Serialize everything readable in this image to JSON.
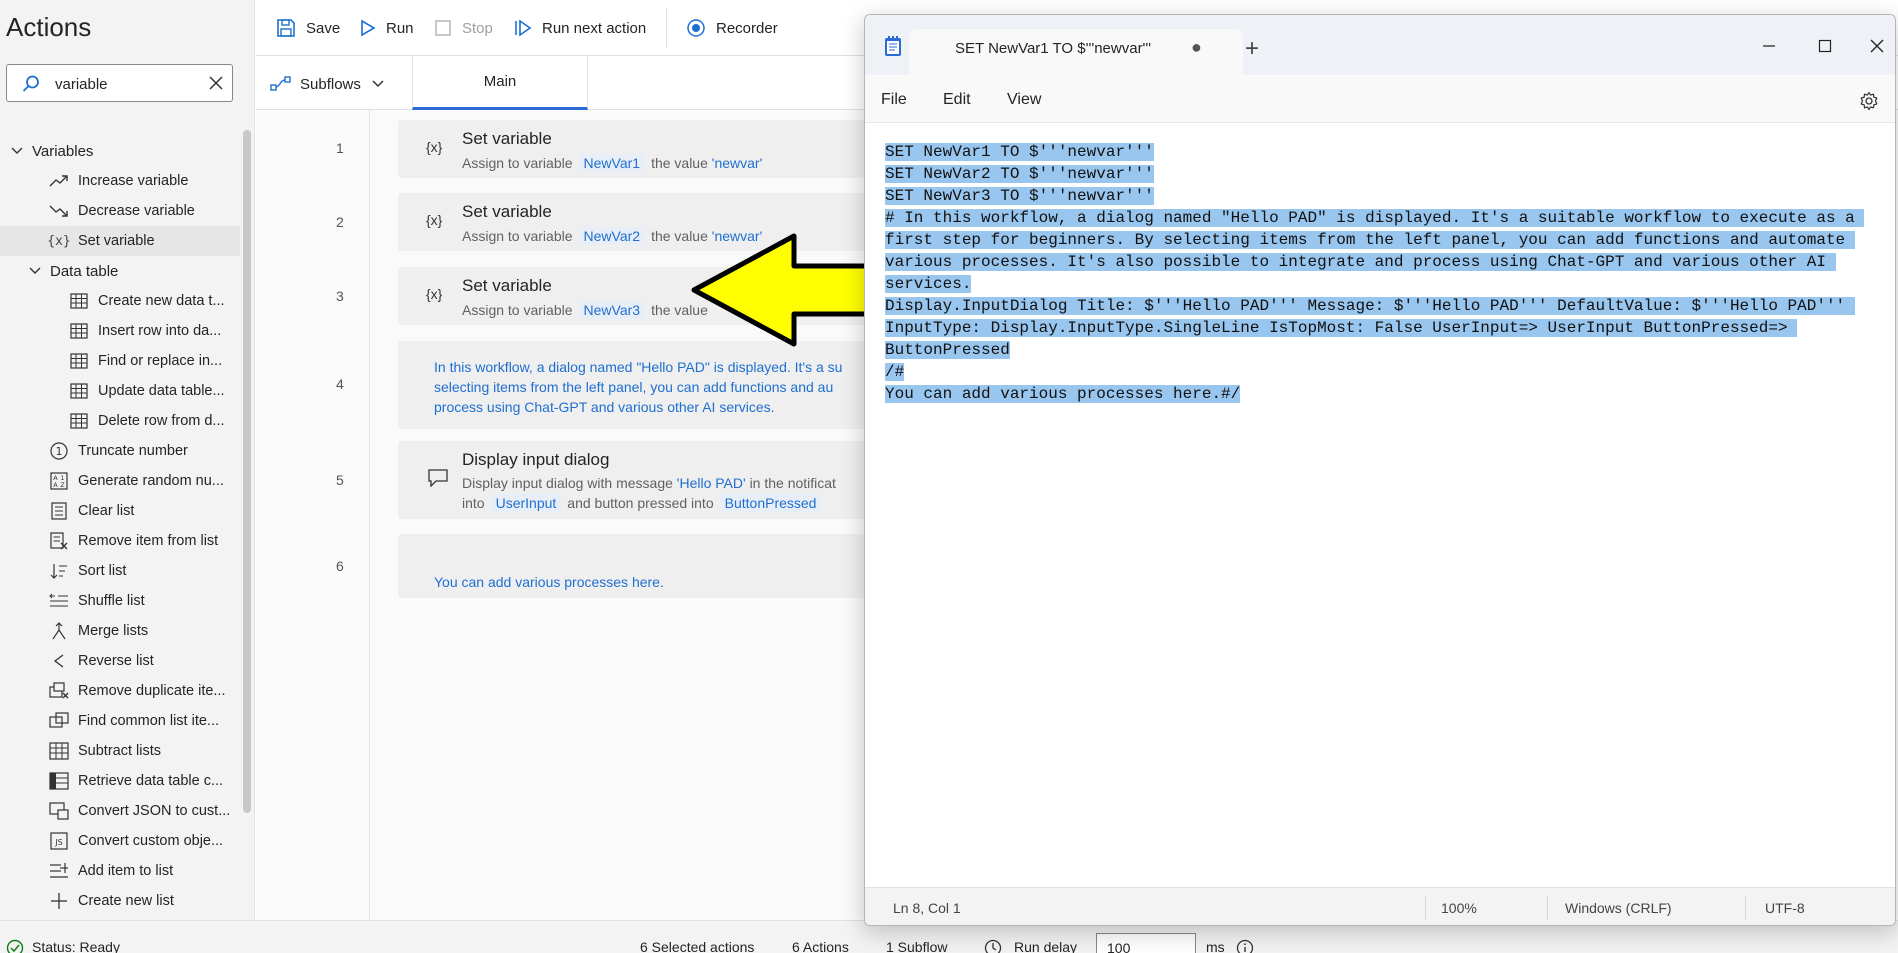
{
  "actions_pane": {
    "title": "Actions",
    "search": {
      "value": "variable",
      "placeholder": ""
    },
    "groups": [
      {
        "label": "Variables",
        "items": [
          {
            "label": "Increase variable",
            "icon": "trend-up-icon"
          },
          {
            "label": "Decrease variable",
            "icon": "trend-down-icon"
          },
          {
            "label": "Set variable",
            "icon": "variable-icon",
            "selected": true
          }
        ]
      },
      {
        "label": "Data table",
        "items": [
          {
            "label": "Create new data t...",
            "icon": "table-icon"
          },
          {
            "label": "Insert row into da...",
            "icon": "table-icon"
          },
          {
            "label": "Find or replace in...",
            "icon": "table-icon"
          },
          {
            "label": "Update data table...",
            "icon": "table-icon"
          },
          {
            "label": "Delete row from d...",
            "icon": "table-icon"
          }
        ]
      }
    ],
    "items": [
      {
        "label": "Truncate number",
        "icon": "number-one-icon"
      },
      {
        "label": "Generate random nu...",
        "icon": "random-icon"
      },
      {
        "label": "Clear list",
        "icon": "list-icon"
      },
      {
        "label": "Remove item from list",
        "icon": "list-remove-icon"
      },
      {
        "label": "Sort list",
        "icon": "sort-icon"
      },
      {
        "label": "Shuffle list",
        "icon": "shuffle-icon"
      },
      {
        "label": "Merge lists",
        "icon": "merge-icon"
      },
      {
        "label": "Reverse list",
        "icon": "reverse-icon"
      },
      {
        "label": "Remove duplicate ite...",
        "icon": "dedupe-icon"
      },
      {
        "label": "Find common list ite...",
        "icon": "common-icon"
      },
      {
        "label": "Subtract lists",
        "icon": "subtract-icon"
      },
      {
        "label": "Retrieve data table c...",
        "icon": "table-icon"
      },
      {
        "label": "Convert JSON to cust...",
        "icon": "json-icon"
      },
      {
        "label": "Convert custom obje...",
        "icon": "js-icon"
      },
      {
        "label": "Add item to list",
        "icon": "list-add-icon"
      },
      {
        "label": "Create new list",
        "icon": "plus-icon"
      }
    ]
  },
  "toolbar": {
    "save": "Save",
    "run": "Run",
    "stop": "Stop",
    "run_next": "Run next action",
    "recorder": "Recorder"
  },
  "tabs": {
    "subflows": "Subflows",
    "main": "Main"
  },
  "flow": {
    "steps": [
      {
        "n": "1",
        "title": "Set variable",
        "prefix": "Assign to variable",
        "var": "NewVar1",
        "mid": "the value",
        "value": "'newvar'"
      },
      {
        "n": "2",
        "title": "Set variable",
        "prefix": "Assign to variable",
        "var": "NewVar2",
        "mid": "the value",
        "value": "'newvar'"
      },
      {
        "n": "3",
        "title": "Set variable",
        "prefix": "Assign to variable",
        "var": "NewVar3",
        "mid": "the value",
        "value": ""
      },
      {
        "n": "4",
        "comment_lines": [
          "In this workflow, a dialog named \"Hello PAD\" is displayed. It's a su",
          "selecting items from the left panel, you can add functions and au",
          "process using Chat-GPT and various other AI services."
        ]
      },
      {
        "n": "5",
        "title": "Display input dialog",
        "line1_prefix": "Display input dialog with message",
        "line1_value": "'Hello PAD'",
        "line1_suffix": "in the notificat",
        "line2_prefix": "into",
        "var": "UserInput",
        "mid": "and button pressed into",
        "var2": "ButtonPressed"
      },
      {
        "n": "6",
        "comment_lines": [
          "You can add various processes here."
        ]
      }
    ]
  },
  "statusbar": {
    "status": "Status: Ready",
    "selected_actions": "6 Selected actions",
    "actions": "6 Actions",
    "subflow": "1 Subflow",
    "run_delay_label": "Run delay",
    "run_delay_value": "100",
    "ms": "ms"
  },
  "notepad": {
    "tab_title": "SET NewVar1 TO $'''newvar'''",
    "menu": {
      "file": "File",
      "edit": "Edit",
      "view": "View"
    },
    "text": "SET NewVar1 TO $'''newvar'''\nSET NewVar2 TO $'''newvar'''\nSET NewVar3 TO $'''newvar'''\n# In this workflow, a dialog named \"Hello PAD\" is displayed. It's a suitable workflow to execute as a first step for beginners. By selecting items from the left panel, you can add functions and automate various processes. It's also possible to integrate and process using Chat-GPT and various other AI services.\nDisplay.InputDialog Title: $'''Hello PAD''' Message: $'''Hello PAD''' DefaultValue: $'''Hello PAD''' InputType: Display.InputType.SingleLine IsTopMost: False UserInput=> UserInput ButtonPressed=> ButtonPressed\n/#\nYou can add various processes here.#/",
    "status": {
      "position": "Ln 8, Col 1",
      "zoom": "100%",
      "line_ending": "Windows (CRLF)",
      "encoding": "UTF-8"
    }
  },
  "colors": {
    "accent": "#2b6bd6",
    "selection": "#99c6ef",
    "arrow_fill": "#ffff00"
  }
}
